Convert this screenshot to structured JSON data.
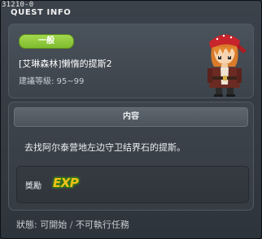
{
  "window": {
    "quest_id": "31210-0",
    "title": "QUEST INFO"
  },
  "quest": {
    "category_tag": "一般",
    "name": "[艾琳森林]懒惰的提斯2",
    "recommended_level": "建議等級: 95~99",
    "npc_portrait": "red-bandana-character-portrait"
  },
  "content": {
    "header": "内容",
    "description": "去找阿尔泰营地左边守卫结界石的提斯。"
  },
  "reward": {
    "label": "獎勵",
    "exp_label": "EXP"
  },
  "status": {
    "label": "狀態",
    "value": "可開始",
    "separator": "/",
    "note": "不可執行任務"
  },
  "colors": {
    "accent_green": "#8cc63f",
    "exp_gold": "#f5c11b",
    "window_bg": "#343a41"
  }
}
